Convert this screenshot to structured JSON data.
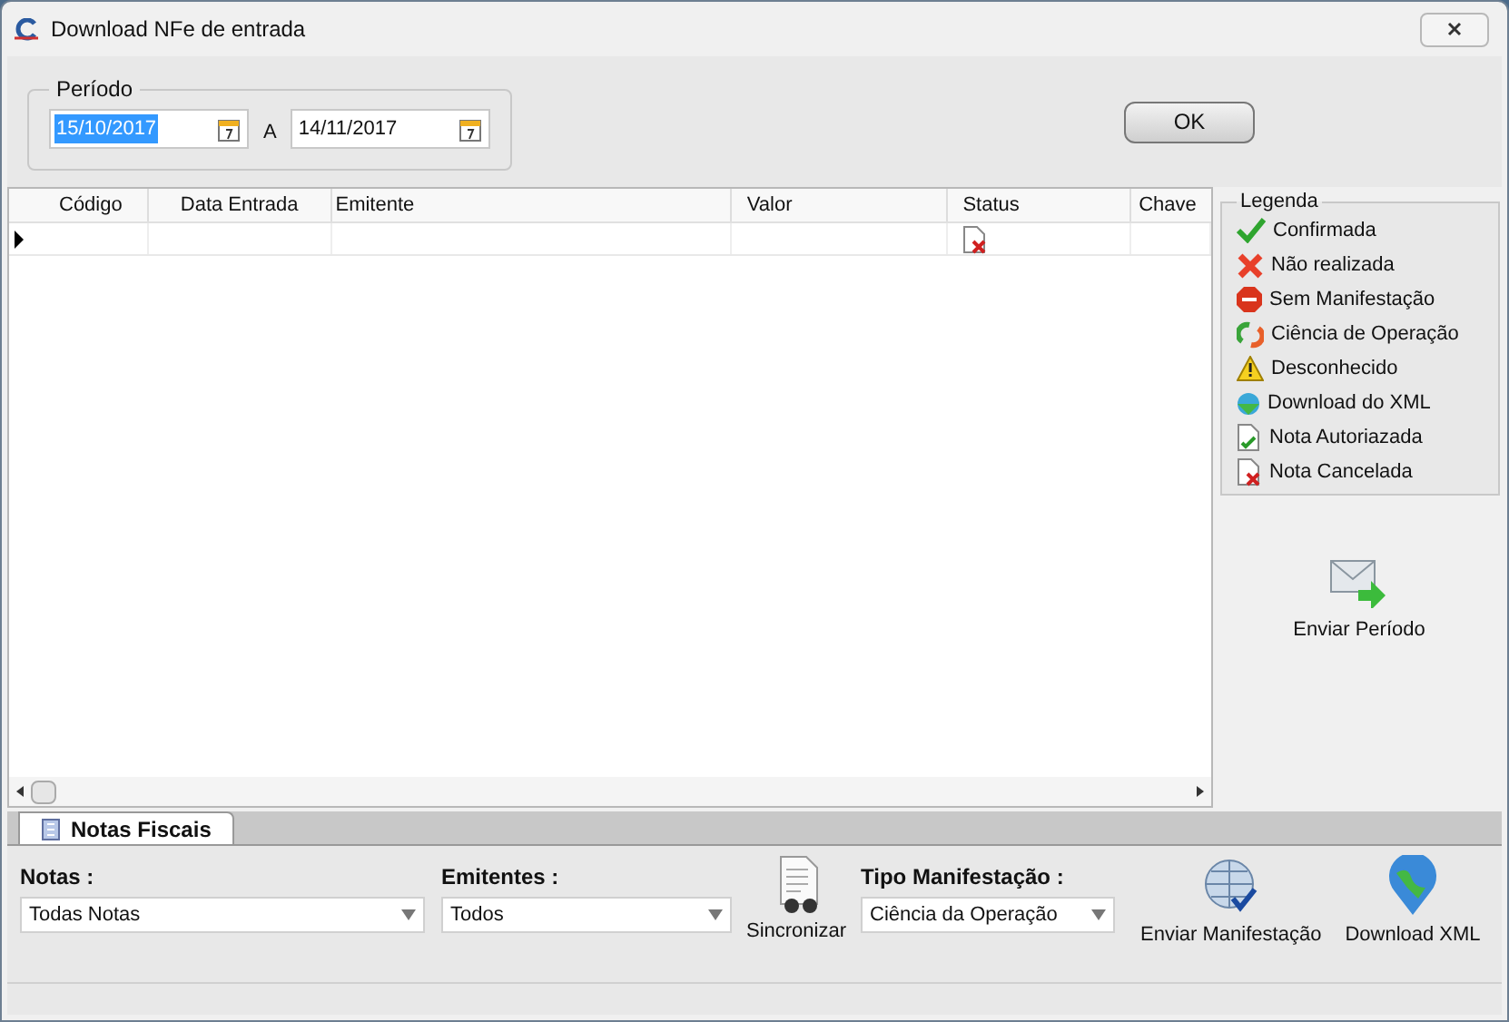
{
  "window": {
    "title": "Download NFe de entrada"
  },
  "period": {
    "label": "Período",
    "start": {
      "value": "15/10/2017",
      "selected": true
    },
    "separator": "A",
    "end": {
      "value": "14/11/2017",
      "selected": false
    }
  },
  "ok_button": "OK",
  "table": {
    "columns": [
      "Código",
      "Data Entrada",
      "Emitente",
      "Valor",
      "Status",
      "Chave"
    ],
    "rows": [
      {
        "selected": true,
        "kind": "cancelled"
      }
    ]
  },
  "legend": {
    "title": "Legenda",
    "items": [
      {
        "kind": "confirmed",
        "label": "Confirmada"
      },
      {
        "kind": "failed",
        "label": "Não realizada"
      },
      {
        "kind": "stop",
        "label": "Sem Manifestação"
      },
      {
        "kind": "science",
        "label": "Ciência de Operação"
      },
      {
        "kind": "warning",
        "label": "Desconhecido"
      },
      {
        "kind": "download",
        "label": "Download do XML"
      },
      {
        "kind": "authorized",
        "label": "Nota Autoriazada"
      },
      {
        "kind": "cancelled",
        "label": "Nota Cancelada"
      }
    ]
  },
  "send_period_button": "Enviar Período",
  "tabs": [
    {
      "label": "Notas Fiscais",
      "selected": true
    }
  ],
  "filters": {
    "notas": {
      "label": "Notas :",
      "value": "Todas Notas"
    },
    "emitentes": {
      "label": "Emitentes :",
      "value": "Todos"
    },
    "sync_button": "Sincronizar",
    "tipo": {
      "label": "Tipo Manifestação :",
      "value": "Ciência da Operação"
    },
    "send_button": "Enviar Manifestação",
    "download_button": "Download XML"
  }
}
